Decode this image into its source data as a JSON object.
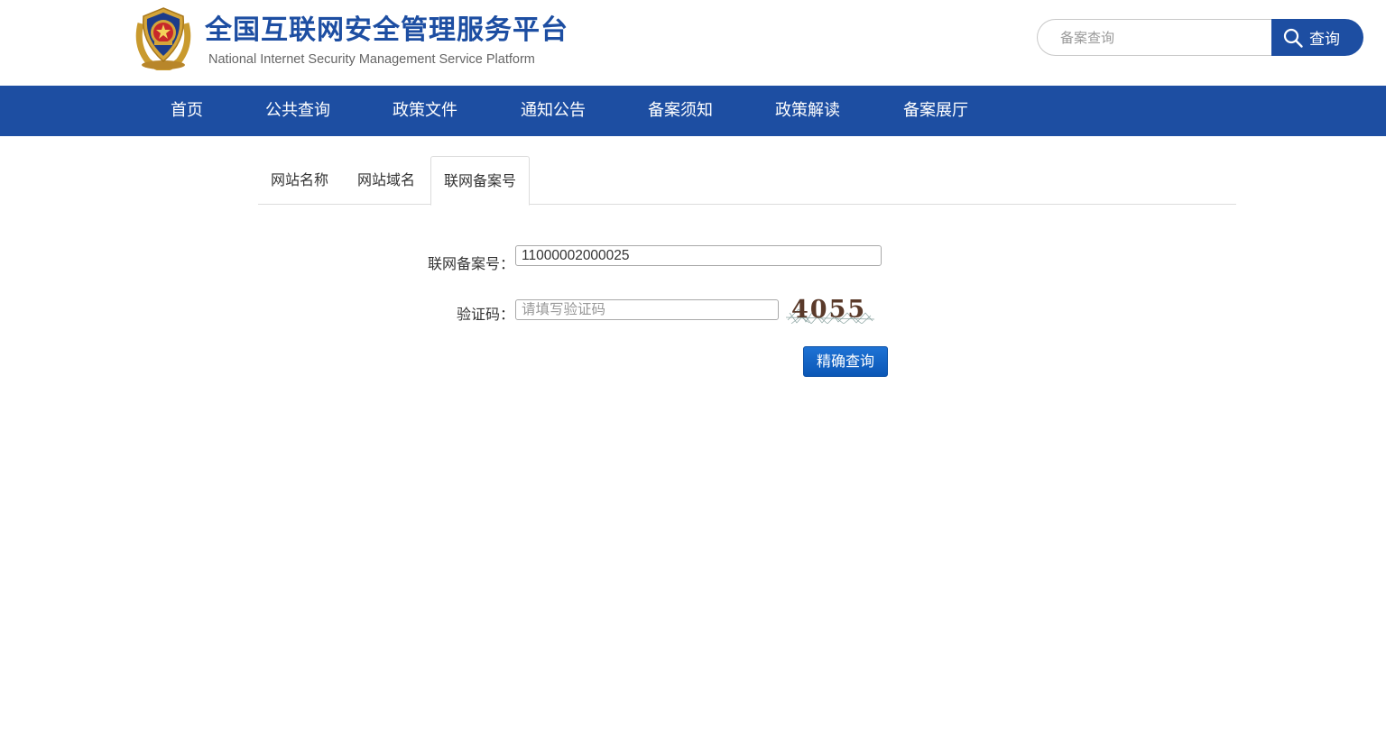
{
  "header": {
    "title": "全国互联网安全管理服务平台",
    "subtitle": "National Internet Security Management Service Platform",
    "search": {
      "placeholder": "备案查询",
      "button_label": "查询"
    }
  },
  "nav": {
    "items": [
      "首页",
      "公共查询",
      "政策文件",
      "通知公告",
      "备案须知",
      "政策解读",
      "备案展厅"
    ]
  },
  "tabs": {
    "items": [
      "网站名称",
      "网站域名",
      "联网备案号"
    ],
    "active": "联网备案号"
  },
  "form": {
    "record_label": "联网备案号：",
    "record_value": "11000002000025",
    "captcha_label": "验证码：",
    "captcha_placeholder": "请填写验证码",
    "captcha_text": "4055",
    "submit_label": "精确查询"
  },
  "colors": {
    "brand_blue": "#1d4ea2",
    "button_blue": "#1565c8"
  }
}
